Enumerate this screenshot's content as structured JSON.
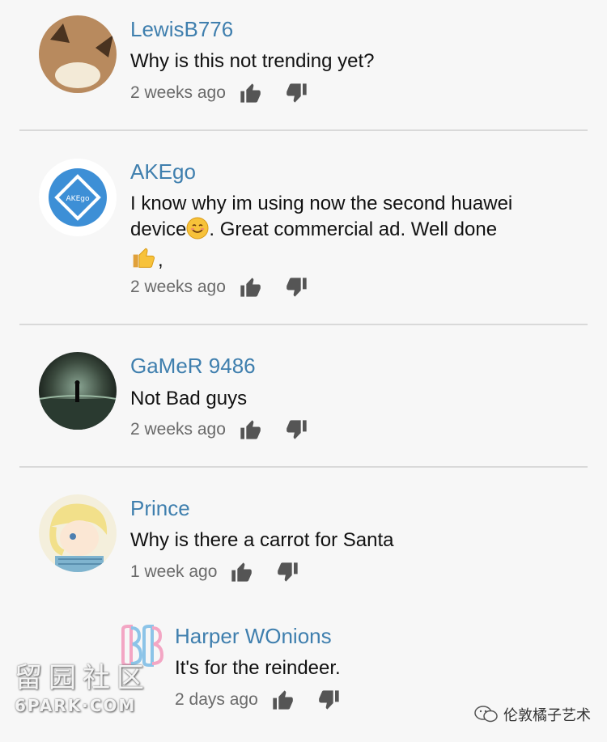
{
  "comments": [
    {
      "author": "LewisB776",
      "text": "Why is this not trending yet?",
      "time": "2 weeks ago"
    },
    {
      "author": "AKEgo",
      "text_part1": "I know why im using now the second huawei device",
      "text_part2": ". Great commercial ad. Well done",
      "text_part3": ",",
      "avatar_text": "AKEgo",
      "time": "2 weeks ago"
    },
    {
      "author": "GaMeR 9486",
      "text": "Not Bad guys",
      "time": "2 weeks ago"
    },
    {
      "author": "Prince",
      "text": "Why is there a carrot for Santa",
      "time": "1 week ago"
    },
    {
      "author": "Harper WOnions",
      "text": "It's for the reindeer.",
      "time": "2 days ago",
      "is_reply": true
    }
  ],
  "icons": {
    "like": "thumbs-up-icon",
    "dislike": "thumbs-down-icon"
  },
  "watermarks": {
    "left_cn": "留园社区",
    "left_en": "6PARK·COM",
    "right": "伦敦橘子艺术"
  },
  "colors": {
    "author": "#3f7fae",
    "divider": "#d9d9d9",
    "background": "#f7f7f7"
  }
}
